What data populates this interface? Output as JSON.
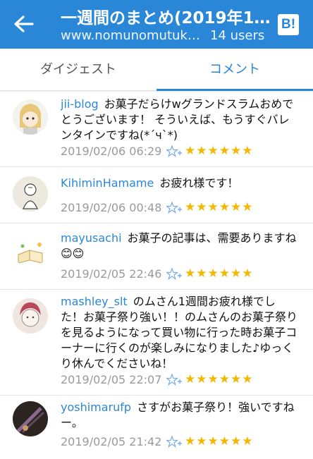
{
  "header": {
    "title": "一週間のまとめ(2019年1…",
    "url": "www.nomunomutuk…",
    "users": "14 users",
    "logo": "B!",
    "accent": "#2a87d8"
  },
  "tabs": [
    {
      "label": "ダイジェスト"
    },
    {
      "label": "コメント"
    }
  ],
  "comments": [
    {
      "user": "jii-blog",
      "text": "お菓子だらけwグランドスラムおめでとうございます！ そういえば、もうすぐバレンタインですね(*´ч`*)",
      "timestamp": "2019/02/06 06:29",
      "stars": "★★★★★★"
    },
    {
      "user": "KihiminHamame",
      "text": "お疲れ様です！",
      "timestamp": "2019/02/06 00:48",
      "stars": "★★★★★★"
    },
    {
      "user": "mayusachi",
      "text": "お菓子の記事は、需要ありますね😊😊",
      "timestamp": "2019/02/05 22:46",
      "stars": "★★★★★★"
    },
    {
      "user": "mashley_slt",
      "text": "のムさん1週間お疲れ様でした！お菓子祭り強い！！のムさんのお菓子祭りを見るようになって買い物に行った時お菓子コーナーに行くのが楽しみになりました♪ゆっくり休んでくださいね！",
      "timestamp": "2019/02/05 22:07",
      "stars": "★★★★★★"
    },
    {
      "user": "yoshimarufp",
      "text": "さすがお菓子祭り！強いですねー。",
      "timestamp": "2019/02/05 21:42",
      "stars": "★★★★★★"
    }
  ]
}
